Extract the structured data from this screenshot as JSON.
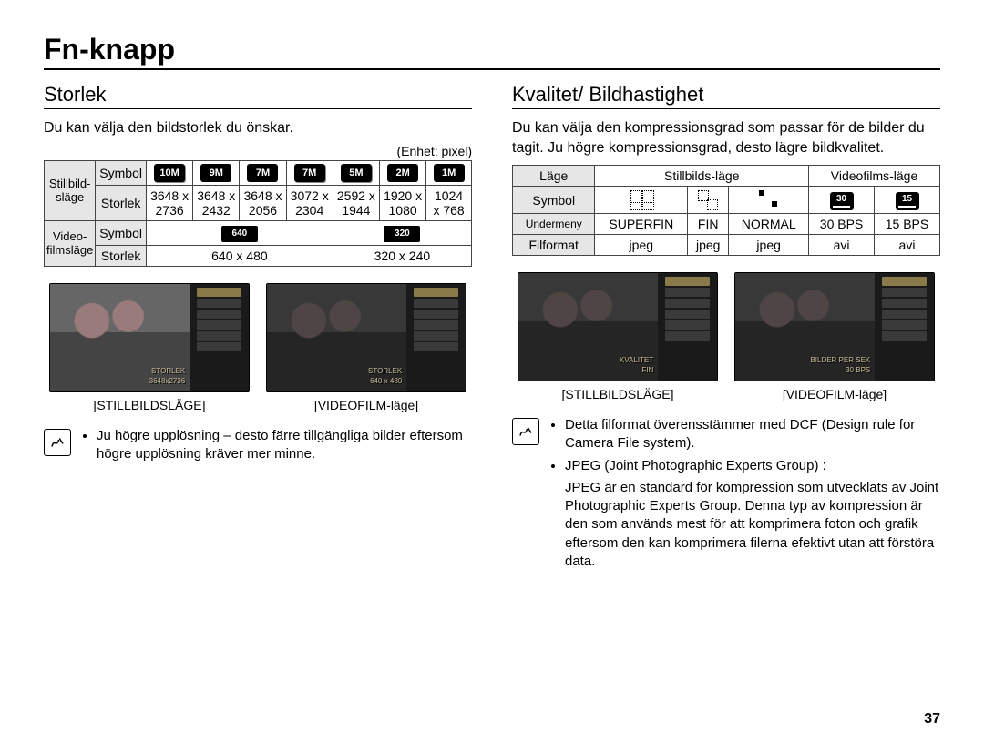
{
  "page_title": "Fn-knapp",
  "page_number": "37",
  "left": {
    "heading": "Storlek",
    "intro": "Du kan välja den bildstorlek du önskar.",
    "unit": "(Enhet: pixel)",
    "still_mode_label": "Stillbild-\nsläge",
    "video_mode_label": "Video-\nfilmsläge",
    "symbol_label": "Symbol",
    "size_label": "Storlek",
    "still_icons": [
      "10M",
      "9M",
      "7M",
      "7M",
      "5M",
      "2M",
      "1M"
    ],
    "still_sizes": [
      "3648 x 2736",
      "3648 x 2432",
      "3648 x 2056",
      "3072 x 2304",
      "2592 x 1944",
      "1920 x 1080",
      "1024 x 768"
    ],
    "video_icons": [
      "640",
      "320"
    ],
    "video_sizes": [
      "640 x 480",
      "320 x 240"
    ],
    "preview1_caption": "[STILLBILDSLÄGE]",
    "preview1_overlay1": "STORLEK",
    "preview1_overlay2": "3648x2736",
    "preview2_caption": "[VIDEOFILM-läge]",
    "preview2_overlay1": "STORLEK",
    "preview2_overlay2": "640 x 480",
    "note_bullet": "Ju högre upplösning – desto färre tillgängliga bilder eftersom högre upplösning kräver mer minne."
  },
  "right": {
    "heading": "Kvalitet/ Bildhastighet",
    "intro": "Du kan välja den kompressionsgrad som passar för de bilder du tagit. Ju högre kompressionsgrad, desto lägre bildkvalitet.",
    "tbl": {
      "mode": "Läge",
      "still_mode": "Stillbilds-läge",
      "video_mode": "Videofilms-läge",
      "symbol": "Symbol",
      "submenu": "Undermeny",
      "fileformat": "Filformat",
      "sub_vals": [
        "SUPERFIN",
        "FIN",
        "NORMAL",
        "30 BPS",
        "15 BPS"
      ],
      "file_vals": [
        "jpeg",
        "jpeg",
        "jpeg",
        "avi",
        "avi"
      ],
      "fr_icons": [
        "30",
        "15"
      ]
    },
    "preview1_caption": "[STILLBILDSLÄGE]",
    "preview1_overlay1": "KVALITET",
    "preview1_overlay2": "FIN",
    "preview2_caption": "[VIDEOFILM-läge]",
    "preview2_overlay1": "BILDER PER SEK",
    "preview2_overlay2": "30 BPS",
    "note_bullets": [
      "Detta filformat överensstämmer med DCF (Design rule for Camera File system).",
      "JPEG (Joint Photographic Experts Group) :"
    ],
    "note_para": "JPEG är en standard för kompression som utvecklats av Joint Photographic Experts Group. Denna typ av kompression är den som används mest för att komprimera foton och grafik eftersom den kan komprimera filerna efektivt utan att förstöra data."
  }
}
